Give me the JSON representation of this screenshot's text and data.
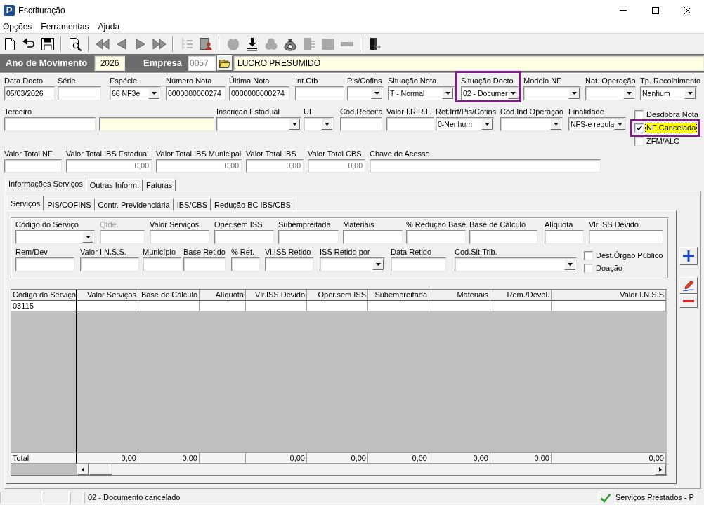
{
  "window": {
    "logo_text": "P",
    "title": "Escrituração"
  },
  "menu": [
    {
      "label": "Opções"
    },
    {
      "label": "Ferramentas"
    },
    {
      "label": "Ajuda"
    }
  ],
  "toolbar": [
    {
      "buttons": [
        {
          "disabled": false
        },
        {
          "disabled": false
        },
        {
          "disabled": false
        }
      ]
    },
    {
      "buttons": [
        {
          "disabled": false
        }
      ]
    },
    {
      "buttons": [
        {
          "disabled": false
        },
        {
          "disabled": false
        },
        {
          "disabled": false
        },
        {
          "disabled": false
        }
      ]
    },
    {
      "buttons": [
        {
          "disabled": true
        },
        {
          "disabled": false
        }
      ]
    },
    {
      "buttons": [
        {
          "disabled": true
        },
        {
          "disabled": false
        },
        {
          "disabled": true
        },
        {
          "disabled": false
        },
        {
          "disabled": true
        },
        {
          "disabled": true
        },
        {
          "disabled": true
        }
      ]
    },
    {
      "buttons": [
        {
          "disabled": false
        }
      ]
    }
  ],
  "header": {
    "year_label": "Ano de Movimento",
    "year": "2026",
    "company_label": "Empresa",
    "company_code": "0057",
    "company_name": "LUCRO PRESUMIDO"
  },
  "document": {
    "row_1": [
      {
        "label": "Data Docto.",
        "kind": "text",
        "value": "05/03/2026",
        "highlighted": false
      },
      {
        "label": "Série",
        "kind": "text",
        "highlighted": false
      },
      {
        "label": "Espécie",
        "kind": "combo",
        "value": "66 NF3e",
        "highlighted": false
      },
      {
        "label": "Número Nota",
        "kind": "text",
        "value": "0000000000274",
        "highlighted": false
      },
      {
        "label": "Última Nota",
        "kind": "text",
        "value": "0000000000274",
        "highlighted": false
      },
      {
        "label": "Int.Ctb",
        "kind": "text",
        "highlighted": false
      },
      {
        "label": "Pis/Cofins",
        "kind": "combo",
        "highlighted": false
      },
      {
        "label": "Situação Nota",
        "kind": "combo",
        "value": "T - Normal",
        "highlighted": false
      },
      {
        "label": "Situação Docto",
        "kind": "combo",
        "value": "02 - Documer",
        "highlighted": true
      },
      {
        "label": "Modelo NF",
        "kind": "combo",
        "highlighted": false
      },
      {
        "label": "Nat. Operação",
        "kind": "combo",
        "highlighted": false
      },
      {
        "label": "Tp. Recolhimento",
        "kind": "combo",
        "value": "Nenhum",
        "highlighted": false
      }
    ],
    "row_2": [
      {
        "label": "Terceiro",
        "kind": "text"
      },
      {
        "kind": "lookup"
      },
      {
        "label": "Inscrição Estadual",
        "kind": "combo"
      },
      {
        "label": "UF",
        "kind": "combo"
      },
      {
        "label": "Cód.Receita",
        "kind": "text"
      },
      {
        "label": "Valor I.R.R.F.",
        "kind": "text"
      },
      {
        "label": "Ret.Irrf/Pis/Cofins",
        "kind": "combo",
        "value": "0-Nenhum"
      },
      {
        "label": "Cód.Ind.Operação",
        "kind": "combo"
      },
      {
        "label": "Finalidade",
        "kind": "combo",
        "value": "NFS-e regula"
      }
    ],
    "flags": [
      {
        "label": "Desdobra Nota",
        "checked": false,
        "focused": false,
        "highlighted": false
      },
      {
        "label": "NF Cancelada",
        "checked": true,
        "focused": true,
        "highlighted": true
      },
      {
        "label": "ZFM/ALC",
        "checked": false,
        "focused": false,
        "highlighted": false
      }
    ],
    "row_3": [
      {
        "label": "Valor Total NF",
        "kind": "text"
      },
      {
        "label": "Valor Total IBS Estadual",
        "kind": "computed",
        "value": "0,00"
      },
      {
        "label": "Valor Total IBS Municipal",
        "kind": "computed",
        "value": "0,00"
      },
      {
        "label": "Valor Total IBS",
        "kind": "computed",
        "value": "0,00"
      },
      {
        "label": "Valor Total CBS",
        "kind": "computed",
        "value": "0,00"
      },
      {
        "label": "Chave de Acesso",
        "kind": "text"
      }
    ]
  },
  "tabs": [
    {
      "label": "Informações Serviços",
      "selected": true
    },
    {
      "label": "Outras Inform.",
      "selected": false
    },
    {
      "label": "Faturas",
      "selected": false
    }
  ],
  "service_tabs": [
    {
      "label": "Serviços",
      "selected": true
    },
    {
      "label": "PIS/COFINS",
      "selected": false
    },
    {
      "label": "Contr. Previdenciária",
      "selected": false
    },
    {
      "label": "IBS/CBS",
      "selected": false
    },
    {
      "label": "Redução BC IBS/CBS",
      "selected": false
    }
  ],
  "service_form": {
    "row_1": [
      {
        "label": "Código do Serviço",
        "kind": "combo"
      },
      {
        "label": "Qtde.",
        "kind": "disabled"
      },
      {
        "label": "Valor Serviços",
        "kind": "text"
      },
      {
        "label": "Oper.sem ISS",
        "kind": "text"
      },
      {
        "label": "Subempreitada",
        "kind": "text"
      },
      {
        "label": "Materiais",
        "kind": "text"
      },
      {
        "label": "% Redução Base",
        "kind": "text"
      },
      {
        "label": "Base de Cálculo",
        "kind": "text"
      },
      {
        "label": "Alíquota",
        "kind": "text"
      },
      {
        "label": "Vlr.ISS Devido",
        "kind": "text"
      }
    ],
    "row_2": [
      {
        "label": "Rem/Dev",
        "kind": "text"
      },
      {
        "label": "Valor I.N.S.S.",
        "kind": "text"
      },
      {
        "label": "Município",
        "kind": "text"
      },
      {
        "label": "Base Retido",
        "kind": "text"
      },
      {
        "label": "% Ret.",
        "kind": "text"
      },
      {
        "label": "Vl.ISS Retido",
        "kind": "text"
      },
      {
        "label": "ISS Retido por",
        "kind": "combo"
      },
      {
        "label": "Data Retido",
        "kind": "text"
      },
      {
        "label": "Cod.Sit.Trib.",
        "kind": "combo"
      }
    ],
    "flags": [
      {
        "label": "Dest.Órgão Público",
        "checked": false
      },
      {
        "label": "Doação",
        "checked": false
      }
    ]
  },
  "services_table": {
    "columns": [
      "Código do Serviço",
      "Valor Serviços",
      "Base de Cálculo",
      "Alíquota",
      "Vlr.ISS Devido",
      "Oper.sem ISS",
      "Subempreitada",
      "Materiais",
      "Rem./Devol.",
      "Valor I.N.S.S"
    ],
    "rows": [
      {
        "cells": [
          "03115"
        ]
      }
    ],
    "footer": {
      "cells": [
        "Total",
        "0,00",
        "0,00",
        null,
        "0,00",
        "0,00",
        "0,00",
        "0,00",
        "0,00",
        "0,00"
      ]
    }
  },
  "status_bar": {
    "message": "02 - Documento cancelado",
    "module": "Serviços Prestados - P"
  }
}
